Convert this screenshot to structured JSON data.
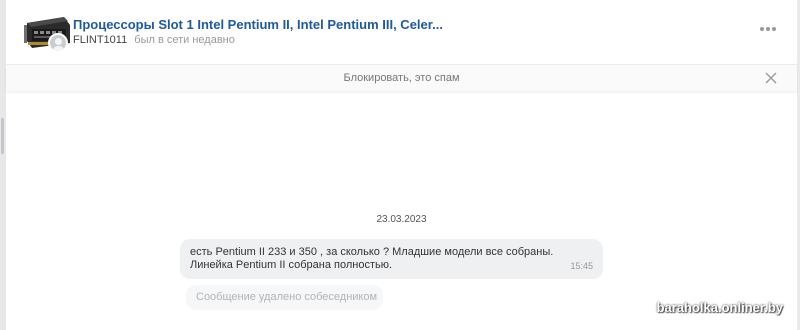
{
  "header": {
    "title": "Процессоры Slot 1 Intel Pentium II, Intel Pentium III, Celer...",
    "username": "FLINT1011",
    "user_status": "был в сети недавно",
    "more_icon": "more-horizontal-icon"
  },
  "spam_bar": {
    "label": "Блокировать, это спам",
    "close_icon": "close-icon"
  },
  "messages": {
    "date": "23.03.2023",
    "items": [
      {
        "text_line1": "есть Pentium II 233 и 350 , за сколько ? Младшие модели все собраны.",
        "text_line2": "Линейка Pentium II собрана полностью.",
        "time": "15:45"
      }
    ],
    "deleted_notice": "Сообщение удалено собеседником"
  },
  "watermark": "baraholka.onliner.by",
  "colors": {
    "title": "#1d5a9f",
    "bubble": "#eff0f2",
    "page_bg": "#ffffff"
  }
}
